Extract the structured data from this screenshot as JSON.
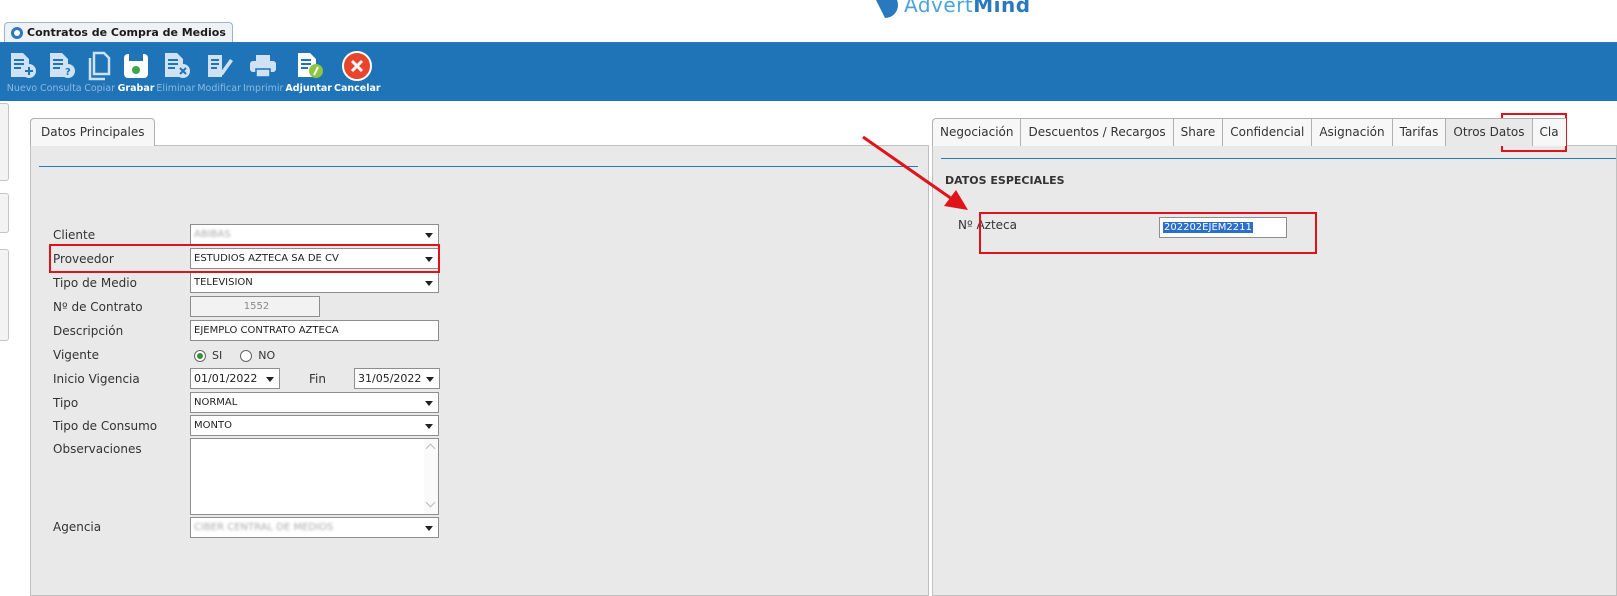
{
  "brand": {
    "prefix": "Advert",
    "suffix": "Mind"
  },
  "window_tab": {
    "title": "Contratos de Compra de Medios"
  },
  "toolbar": {
    "buttons": [
      {
        "label": "Nuevo",
        "enabled": false,
        "icon": "document-plus-icon"
      },
      {
        "label": "Consulta",
        "enabled": false,
        "icon": "document-question-icon"
      },
      {
        "label": "Copiar",
        "enabled": false,
        "icon": "copy-icon"
      },
      {
        "label": "Grabar",
        "enabled": true,
        "icon": "save-icon"
      },
      {
        "label": "Eliminar",
        "enabled": false,
        "icon": "document-delete-icon"
      },
      {
        "label": "Modificar",
        "enabled": false,
        "icon": "edit-icon"
      },
      {
        "label": "Imprimir",
        "enabled": false,
        "icon": "printer-icon"
      },
      {
        "label": "Adjuntar",
        "enabled": true,
        "icon": "attach-icon"
      },
      {
        "label": "Cancelar",
        "enabled": true,
        "icon": "cancel-icon"
      }
    ]
  },
  "left": {
    "tab_label": "Datos Principales",
    "fields": {
      "cliente": {
        "label": "Cliente",
        "value": "ABIBAS"
      },
      "proveedor": {
        "label": "Proveedor",
        "value": "ESTUDIOS AZTECA SA DE CV"
      },
      "tipo_medio": {
        "label": "Tipo de Medio",
        "value": "TELEVISION"
      },
      "no_contrato": {
        "label": "Nº de Contrato",
        "value": "1552"
      },
      "descripcion": {
        "label": "Descripción",
        "value": "EJEMPLO CONTRATO AZTECA"
      },
      "vigente": {
        "label": "Vigente",
        "options": [
          "SI",
          "NO"
        ],
        "selected": "SI"
      },
      "inicio_vigencia": {
        "label": "Inicio Vigencia",
        "value": "01/01/2022"
      },
      "fin": {
        "label": "Fin",
        "value": "31/05/2022"
      },
      "tipo": {
        "label": "Tipo",
        "value": "NORMAL"
      },
      "tipo_consumo": {
        "label": "Tipo de Consumo",
        "value": "MONTO"
      },
      "observaciones": {
        "label": "Observaciones",
        "value": ""
      },
      "agencia": {
        "label": "Agencia",
        "value": "CIBER CENTRAL DE MEDIOS"
      }
    }
  },
  "right": {
    "tabs": [
      "Negociación",
      "Descuentos / Recargos",
      "Share",
      "Confidencial",
      "Asignación",
      "Tarifas",
      "Otros Datos",
      "Cla"
    ],
    "active_tab": "Otros Datos",
    "section_title": "DATOS ESPECIALES",
    "no_azteca": {
      "label": "Nº Azteca",
      "value": "202202EJEM2211"
    }
  },
  "colors": {
    "toolbar": "#1f73b7",
    "accent": "#2a79bf",
    "highlight": "#e0121a"
  }
}
